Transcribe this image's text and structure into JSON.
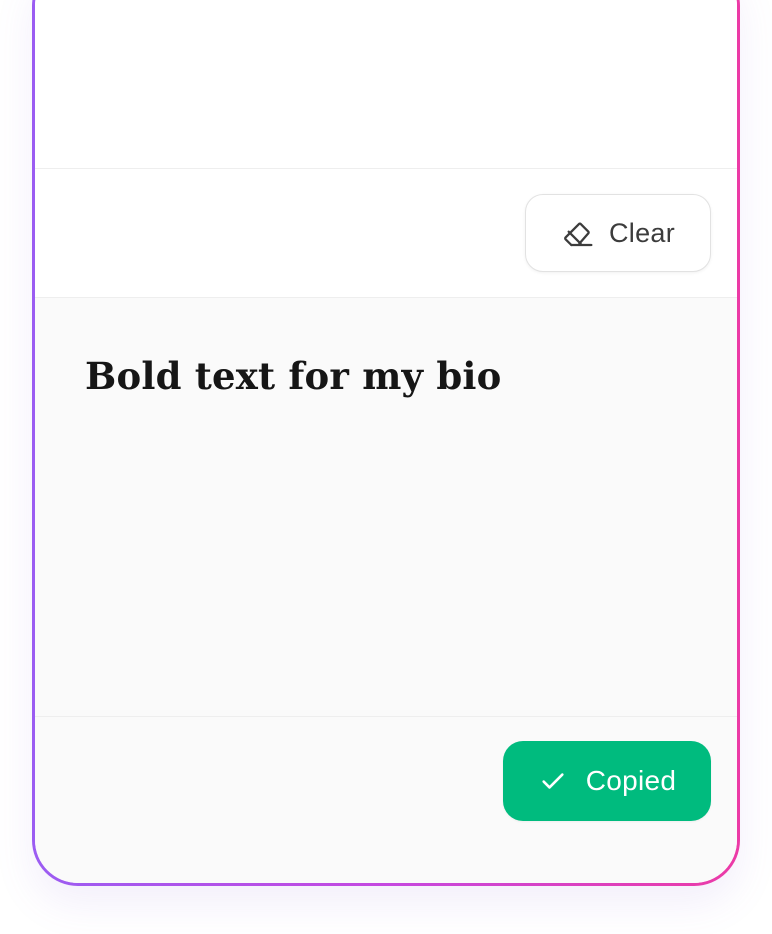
{
  "input": {
    "clear_label": "Clear"
  },
  "output": {
    "text": "Bold text for my bio",
    "copy_label": "Copied"
  },
  "icons": {
    "clear": "eraser-icon",
    "copied": "check-icon"
  },
  "colors": {
    "border_gradient_start": "#9b5cf2",
    "border_gradient_end": "#ec3aa6",
    "copied_button": "#00bb7e",
    "output_background": "#fafafa"
  }
}
